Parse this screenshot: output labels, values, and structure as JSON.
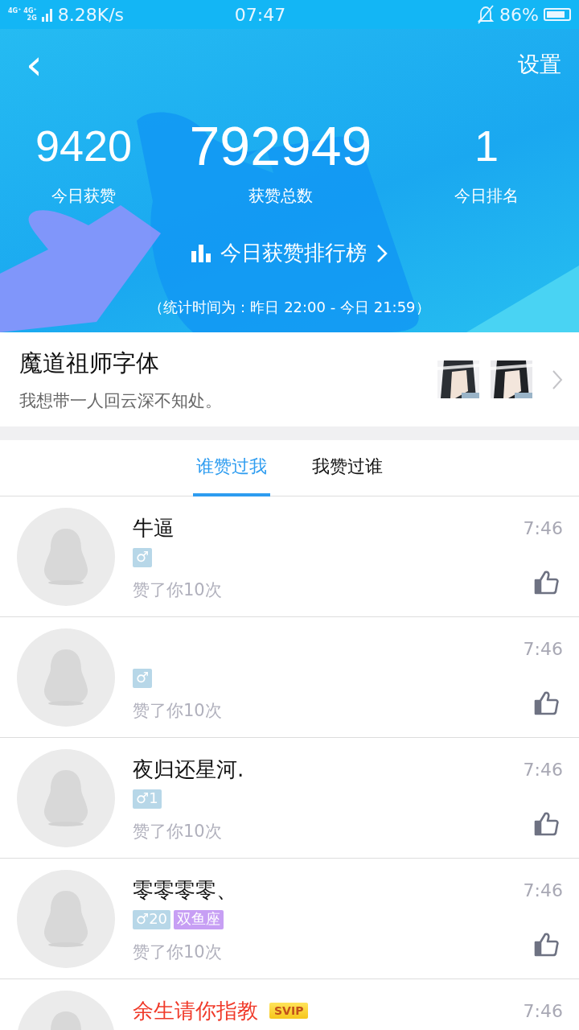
{
  "status_bar": {
    "network_top": [
      "4G⁺",
      "4G⁺"
    ],
    "network_bottom": "2G",
    "speed": "8.28K/s",
    "time": "07:47",
    "battery_text": "86%"
  },
  "header": {
    "back": "‹",
    "settings": "设置"
  },
  "stats": [
    {
      "value": "9420",
      "label": "今日获赞",
      "main": false
    },
    {
      "value": "792949",
      "label": "获赞总数",
      "main": true
    },
    {
      "value": "1",
      "label": "今日排名",
      "main": false
    }
  ],
  "leaderboard": {
    "label": "今日获赞排行榜"
  },
  "period_note": "（统计时间为：昨日 22:00 - 今日 21:59）",
  "font_card": {
    "title": "魔道祖师字体",
    "subtitle": "我想带一人回云深不知处。"
  },
  "tabs": [
    {
      "label": "谁赞过我",
      "selected": true
    },
    {
      "label": "我赞过谁",
      "selected": false
    }
  ],
  "rows": [
    {
      "name": "牛逼",
      "vip": false,
      "badges": [
        {
          "kind": "gender",
          "text": "♂"
        }
      ],
      "note": "赞了你10次",
      "time": "7:46"
    },
    {
      "badges": [
        {
          "kind": "gender",
          "text": "♂"
        }
      ],
      "note": "赞了你10次",
      "time": "7:46"
    },
    {
      "name": "夜归还星河.",
      "vip": false,
      "badges": [
        {
          "kind": "gender",
          "text": "♂1"
        }
      ],
      "note": "赞了你10次",
      "time": "7:46"
    },
    {
      "name": "零零零零、",
      "vip": false,
      "badges": [
        {
          "kind": "gender",
          "text": "♂20"
        },
        {
          "kind": "constellation",
          "text": "双鱼座"
        }
      ],
      "note": "赞了你10次",
      "time": "7:46"
    },
    {
      "name": "余生请你指教",
      "vip": true,
      "vip_badge": "SVIP",
      "time": "7:46"
    }
  ]
}
